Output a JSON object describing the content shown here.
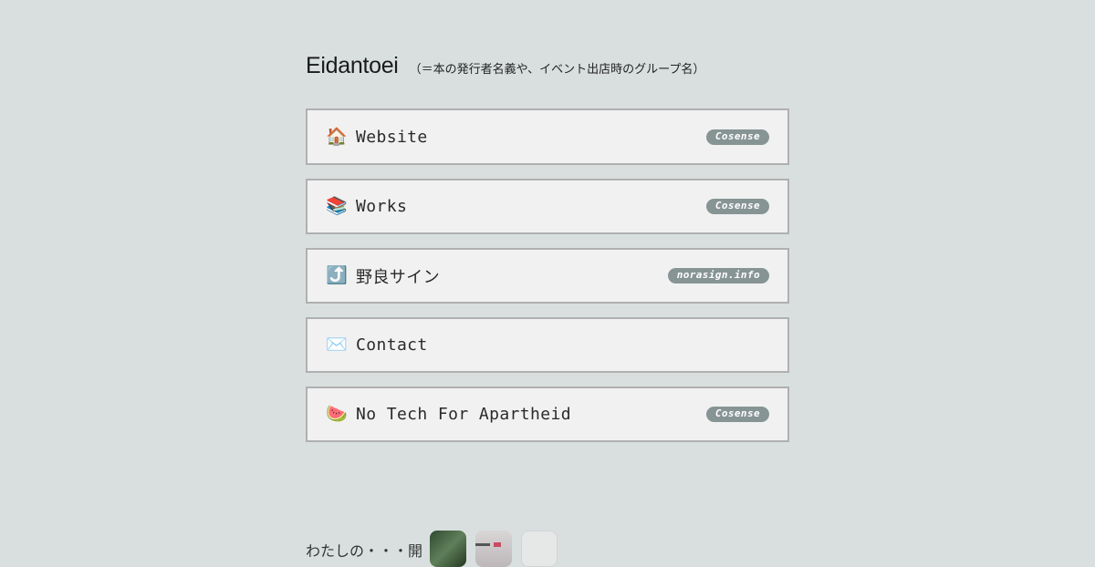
{
  "header": {
    "title": "Eidantoei",
    "subtitle": "（＝本の発行者名義や、イベント出店時のグループ名）"
  },
  "links": [
    {
      "emoji": "🏠",
      "icon": "house-icon",
      "label": "Website",
      "badge": "Cosense"
    },
    {
      "emoji": "📚",
      "icon": "books-icon",
      "label": "Works",
      "badge": "Cosense"
    },
    {
      "emoji": "⤴️",
      "icon": "arrow-up-right-icon",
      "label": "野良サイン",
      "badge": "norasign.info"
    },
    {
      "emoji": "✉️",
      "icon": "envelope-icon",
      "label": "Contact",
      "badge": ""
    },
    {
      "emoji": "🍉",
      "icon": "watermelon-icon",
      "label": "No Tech For Apartheid",
      "badge": "Cosense"
    }
  ],
  "footer": {
    "text": "わたしの・・・開"
  },
  "colors": {
    "background": "#d9dfdf",
    "card_background": "#f1f1f1",
    "card_border": "#b0b0b0",
    "badge": "#879494"
  }
}
